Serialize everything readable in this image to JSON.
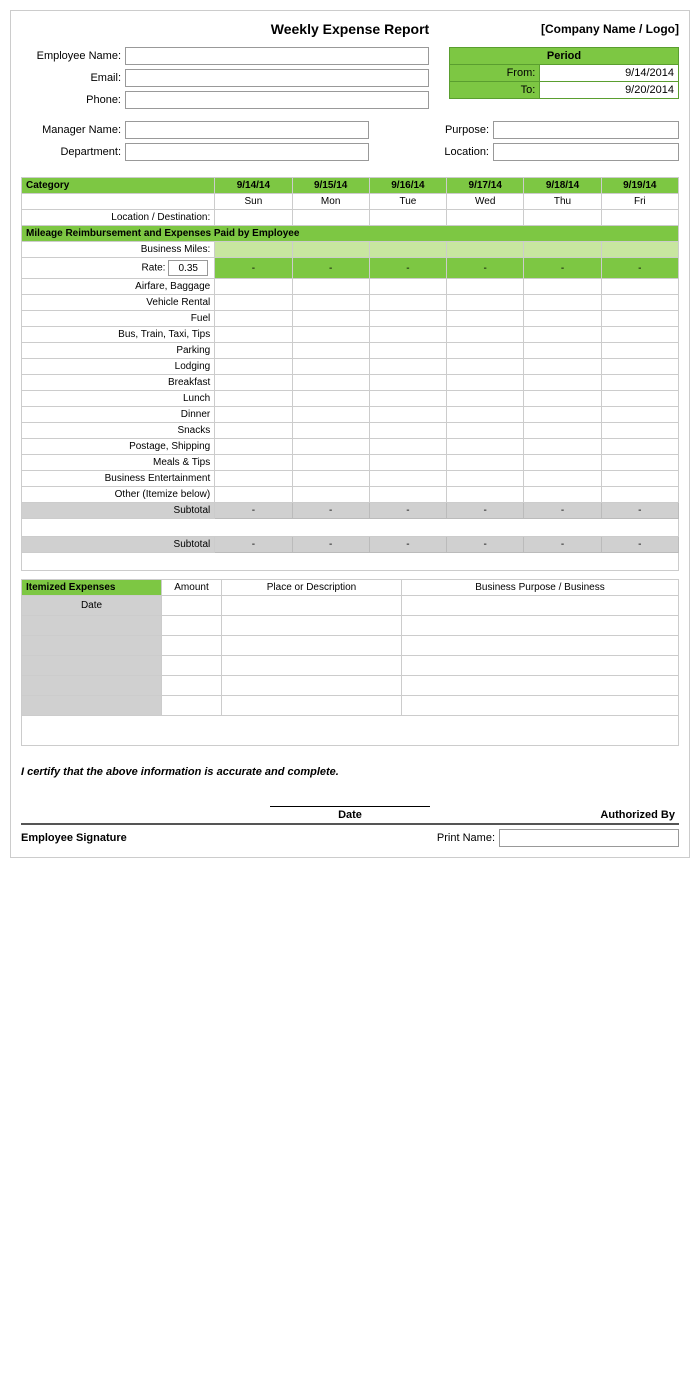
{
  "header": {
    "title": "Weekly Expense Report",
    "company": "[Company Name / Logo]"
  },
  "employee": {
    "name_label": "Employee Name:",
    "email_label": "Email:",
    "phone_label": "Phone:"
  },
  "period": {
    "label": "Period",
    "from_label": "From:",
    "from_value": "9/14/2014",
    "to_label": "To:",
    "to_value": "9/20/2014"
  },
  "manager": {
    "name_label": "Manager Name:",
    "department_label": "Department:",
    "purpose_label": "Purpose:",
    "location_label": "Location:"
  },
  "table": {
    "category_label": "Category",
    "dates": [
      "9/14/14",
      "9/15/14",
      "9/16/14",
      "9/17/14",
      "9/18/14",
      "9/19/14"
    ],
    "days": [
      "Sun",
      "Mon",
      "Tue",
      "Wed",
      "Thu",
      "Fri"
    ],
    "location_row": "Location / Destination:",
    "mileage_section": "Mileage Reimbursement and Expenses Paid by Employee",
    "business_miles_label": "Business Miles:",
    "rate_label": "Rate:",
    "rate_value": "0.35",
    "categories": [
      "Airfare, Baggage",
      "Vehicle Rental",
      "Fuel",
      "Bus, Train, Taxi, Tips",
      "Parking",
      "Lodging",
      "Breakfast",
      "Lunch",
      "Dinner",
      "Snacks",
      "Postage, Shipping",
      "Meals & Tips",
      "Business Entertainment",
      "Other (Itemize below)"
    ],
    "subtotal_label": "Subtotal",
    "dash": "-"
  },
  "itemized": {
    "header": "Itemized Expenses",
    "amount_col": "Amount",
    "place_col": "Place or Description",
    "purpose_col": "Business Purpose / Business",
    "date_col": "Date"
  },
  "certification": {
    "text": "I certify that the above information is accurate and complete."
  },
  "signature": {
    "date_label": "Date",
    "authorized_label": "Authorized By",
    "employee_sig_label": "Employee Signature",
    "print_name_label": "Print Name:"
  }
}
